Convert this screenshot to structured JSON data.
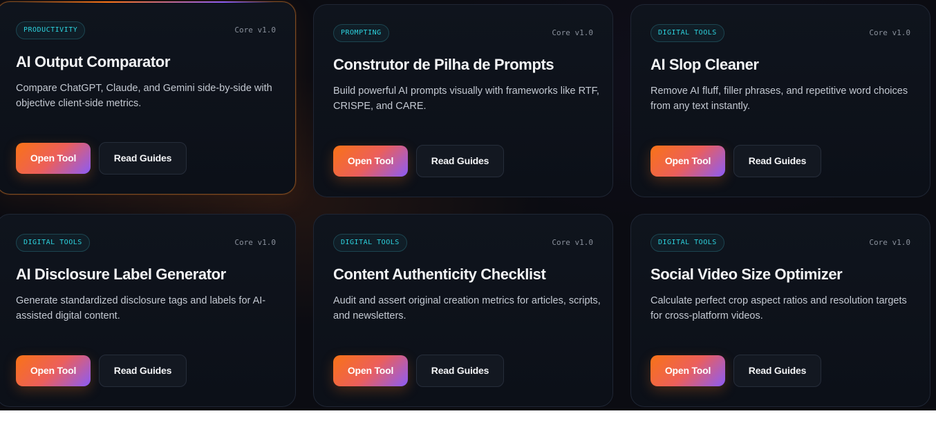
{
  "cards": [
    {
      "badge": "PRODUCTIVITY",
      "version": "Core v1.0",
      "title": "AI Output Comparator",
      "description": "Compare ChatGPT, Claude, and Gemini side-by-side with objective client-side metrics.",
      "open_label": "Open Tool",
      "guides_label": "Read Guides"
    },
    {
      "badge": "PROMPTING",
      "version": "Core v1.0",
      "title": "Construtor de Pilha de Prompts",
      "description": "Build powerful AI prompts visually with frameworks like RTF, CRISPE, and CARE.",
      "open_label": "Open Tool",
      "guides_label": "Read Guides"
    },
    {
      "badge": "DIGITAL TOOLS",
      "version": "Core v1.0",
      "title": "AI Slop Cleaner",
      "description": "Remove AI fluff, filler phrases, and repetitive word choices from any text instantly.",
      "open_label": "Open Tool",
      "guides_label": "Read Guides"
    },
    {
      "badge": "DIGITAL TOOLS",
      "version": "Core v1.0",
      "title": "AI Disclosure Label Generator",
      "description": "Generate standardized disclosure tags and labels for AI-assisted digital content.",
      "open_label": "Open Tool",
      "guides_label": "Read Guides"
    },
    {
      "badge": "DIGITAL TOOLS",
      "version": "Core v1.0",
      "title": "Content Authenticity Checklist",
      "description": "Audit and assert original creation metrics for articles, scripts, and newsletters.",
      "open_label": "Open Tool",
      "guides_label": "Read Guides"
    },
    {
      "badge": "DIGITAL TOOLS",
      "version": "Core v1.0",
      "title": "Social Video Size Optimizer",
      "description": "Calculate perfect crop aspect ratios and resolution targets for cross-platform videos.",
      "open_label": "Open Tool",
      "guides_label": "Read Guides"
    }
  ],
  "colors": {
    "background": "#0b0c12",
    "card": "#0f141d",
    "badge_text": "#2dd4df",
    "accent_start": "#f97316",
    "accent_end": "#8b5cf6"
  }
}
